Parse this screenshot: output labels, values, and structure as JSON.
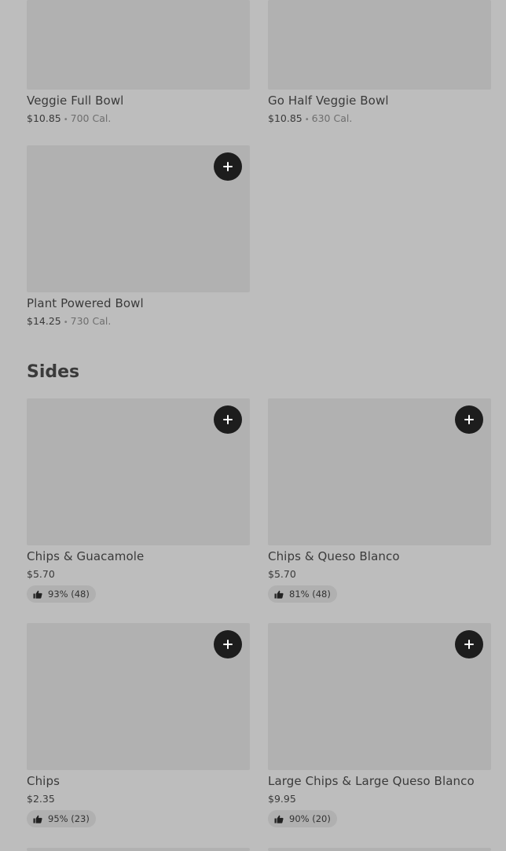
{
  "top_items": [
    {
      "name": "Veggie Full Bowl",
      "price": "$10.85",
      "separator": "•",
      "calories": "700 Cal."
    },
    {
      "name": "Go Half Veggie Bowl",
      "price": "$10.85",
      "separator": "•",
      "calories": "630 Cal."
    },
    {
      "name": "Plant Powered Bowl",
      "price": "$14.25",
      "separator": "•",
      "calories": "730 Cal."
    }
  ],
  "sides": {
    "heading": "Sides",
    "items": [
      {
        "name": "Chips & Guacamole",
        "price": "$5.70",
        "rating": "93% (48)"
      },
      {
        "name": "Chips & Queso Blanco",
        "price": "$5.70",
        "rating": "81% (48)"
      },
      {
        "name": "Chips",
        "price": "$2.35",
        "rating": "95% (23)"
      },
      {
        "name": "Large Chips & Large Queso Blanco",
        "price": "$9.95",
        "rating": "90% (20)"
      }
    ]
  },
  "icons": {
    "add": "plus-icon",
    "rating": "thumbs-up-icon"
  }
}
